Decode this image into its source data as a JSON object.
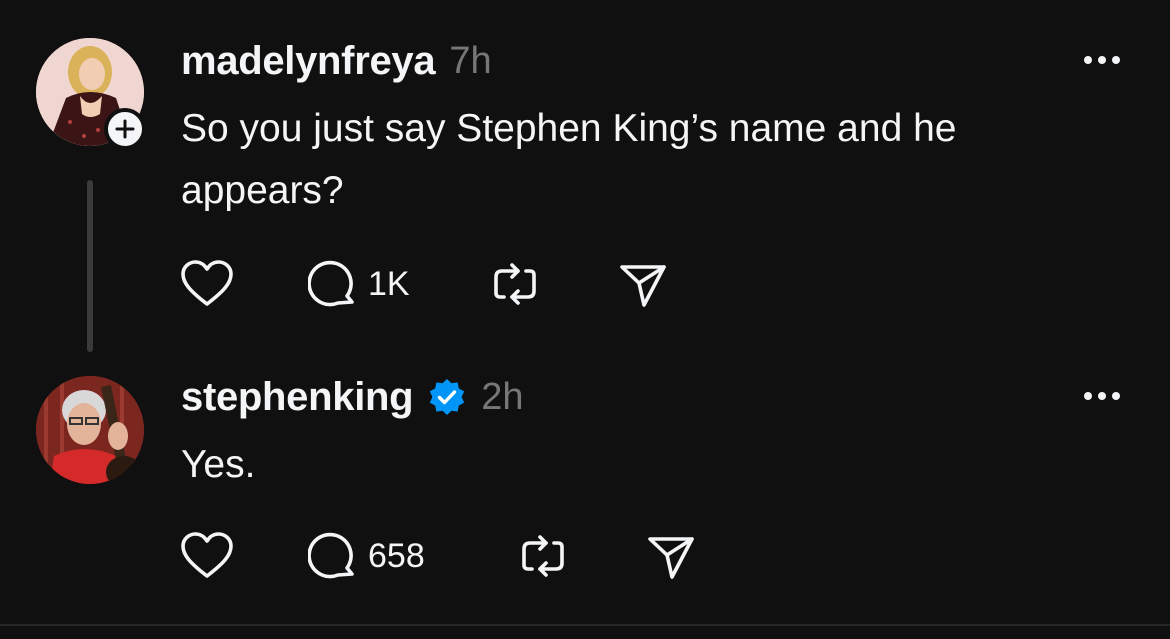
{
  "posts": [
    {
      "username": "madelynfreya",
      "timestamp": "7h",
      "verified": false,
      "text": "So you just say Stephen King’s name and he appears?",
      "reply_count": "1K",
      "avatar_icon": "avatar-madelynfreya",
      "follow_icon": "plus-icon"
    },
    {
      "username": "stephenking",
      "timestamp": "2h",
      "verified": true,
      "text": "Yes.",
      "reply_count": "658",
      "avatar_icon": "avatar-stephenking"
    }
  ],
  "icons": {
    "like": "heart-icon",
    "reply": "comment-icon",
    "repost": "repost-icon",
    "share": "send-icon",
    "more": "more-options-icon",
    "verified": "verified-badge-icon"
  },
  "colors": {
    "background": "#101010",
    "text_primary": "#f3f5f7",
    "text_secondary": "#777777",
    "verified_blue": "#0095f6",
    "thread_line": "#3a3a3a"
  }
}
